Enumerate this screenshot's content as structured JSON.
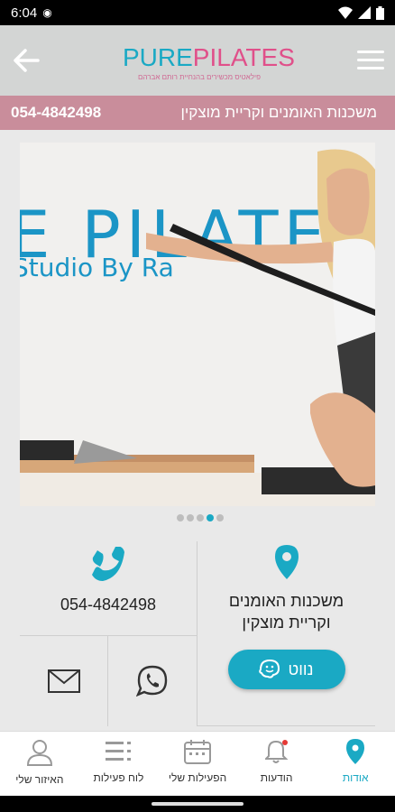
{
  "status": {
    "time": "6:04"
  },
  "header": {
    "logo_pure": "PURE",
    "logo_pilates": "PILATES",
    "logo_tagline": "פילאטיס מכשירים בהנחיית רותם אברהם"
  },
  "infobar": {
    "phone": "054-4842498",
    "location": "משכנות האומנים וקריית מוצקין"
  },
  "hero": {
    "brand_text": "E PILATES",
    "brand_sub": "Studio By Ra",
    "slides": [
      false,
      false,
      false,
      true,
      false
    ]
  },
  "contact": {
    "phone": "054-4842498",
    "address_line1": "משכנות האומנים",
    "address_line2": "וקריית מוצקין",
    "waze_label": "נווט"
  },
  "nav": {
    "items": [
      {
        "label": "אודות",
        "icon": "location-pin-icon"
      },
      {
        "label": "הודעות",
        "icon": "bell-icon"
      },
      {
        "label": "הפעילות שלי",
        "icon": "calendar-icon"
      },
      {
        "label": "לוח פעילות",
        "icon": "list-icon"
      },
      {
        "label": "האיזור שלי",
        "icon": "user-icon"
      }
    ]
  },
  "colors": {
    "accent": "#1aa9c4",
    "pink": "#e0508a",
    "infobar": "#c98d9b"
  }
}
